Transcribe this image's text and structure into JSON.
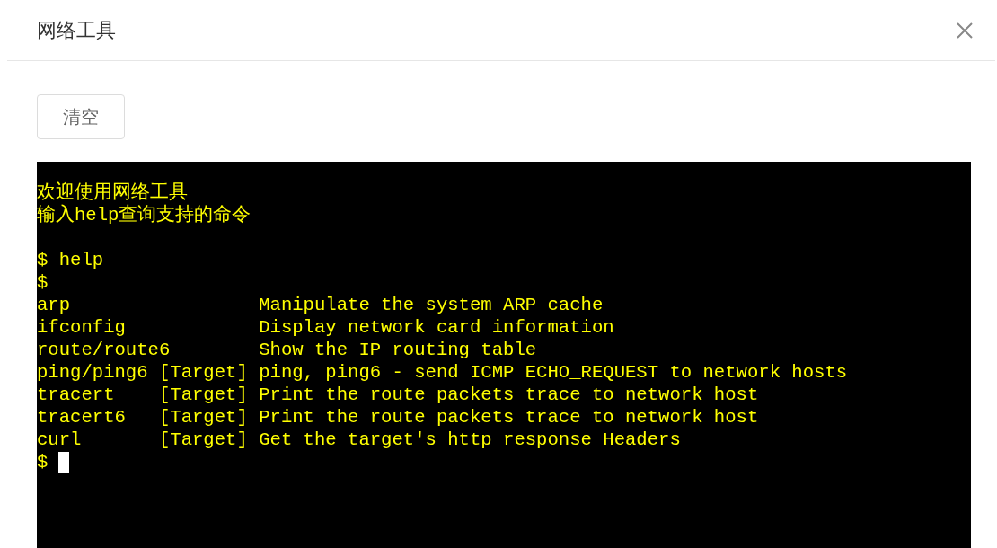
{
  "dialog": {
    "title": "网络工具"
  },
  "toolbar": {
    "clear_button": "清空"
  },
  "terminal": {
    "lines": [
      {
        "kind": "text",
        "text": "欢迎使用网络工具"
      },
      {
        "kind": "text",
        "text": "输入help查询支持的命令"
      },
      {
        "kind": "blank"
      },
      {
        "kind": "text",
        "text": "$ help"
      },
      {
        "kind": "text",
        "text": "$"
      },
      {
        "kind": "text",
        "text": "arp                 Manipulate the system ARP cache"
      },
      {
        "kind": "text",
        "text": "ifconfig            Display network card information"
      },
      {
        "kind": "text",
        "text": "route/route6        Show the IP routing table"
      },
      {
        "kind": "text",
        "text": "ping/ping6 [Target] ping, ping6 - send ICMP ECHO_REQUEST to network hosts"
      },
      {
        "kind": "text",
        "text": "tracert    [Target] Print the route packets trace to network host"
      },
      {
        "kind": "text",
        "text": "tracert6   [Target] Print the route packets trace to network host"
      },
      {
        "kind": "text",
        "text": "curl       [Target] Get the target's http response Headers"
      }
    ],
    "prompt": "$",
    "cursor": true
  }
}
